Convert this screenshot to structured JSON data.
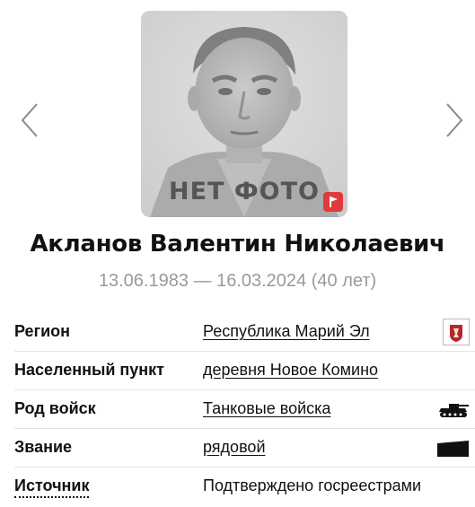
{
  "photo": {
    "placeholder_text": "НЕТ ФОТО",
    "flag_icon": "flag-icon"
  },
  "navigation": {
    "prev_icon": "chevron-left-icon",
    "next_icon": "chevron-right-icon"
  },
  "person": {
    "name": "Акланов Валентин Николаевич",
    "dates": "13.06.1983 — 16.03.2024 (40 лет)"
  },
  "details": [
    {
      "label": "Регион",
      "value": "Республика Марий Эл",
      "icon": "coat-of-arms-icon"
    },
    {
      "label": "Населенный пункт",
      "value": "деревня Новое Комино"
    },
    {
      "label": "Род войск",
      "value": "Танковые войска",
      "icon": "tank-icon"
    },
    {
      "label": "Звание",
      "value": "рядовой",
      "icon": "rank-insignia-icon"
    },
    {
      "label": "Источник",
      "value": "Подтверждено госреестрами"
    }
  ],
  "colors": {
    "badge_red": "#e03a3a",
    "muted_text": "#9a9a9a",
    "coat_of_arms_red": "#b8262e"
  }
}
